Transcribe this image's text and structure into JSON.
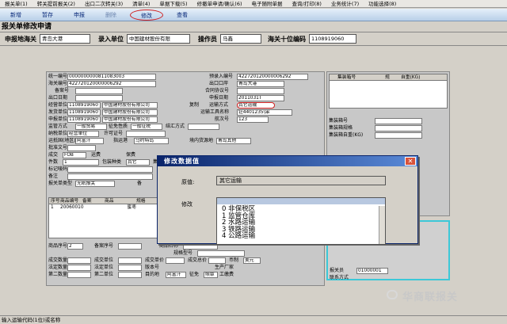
{
  "menu": [
    "报关单(1)",
    "转关提前报关(2)",
    "出口二次转关(3)",
    "清单(4)",
    "单据下载(5)",
    "修撤单申请/确认(6)",
    "电子随附单据",
    "查询/打印(8)",
    "业务统计(7)",
    "功能选择(8)"
  ],
  "toolbar": {
    "new": "新增",
    "save": "暂存",
    "declare": "申报",
    "delete": "删除",
    "modify": "修改",
    "view": "查看"
  },
  "window_title": "报关单修改申请",
  "header": {
    "customs_label": "申报地海关",
    "customs_value": "青岛大港",
    "unit_label": "录入单位",
    "unit_value": "中国建材股份有限",
    "operator_label": "操作员",
    "operator_value": "马鑫",
    "code_label": "海关十位编码",
    "code_value": "1108919060"
  },
  "form": {
    "unified_no_label": "统一编号",
    "unified_no": "0000000000811083003",
    "pre_entry_label": "预录入编号",
    "pre_entry": "422720120000006292",
    "customs_no_label": "海关编号",
    "customs_no": "422720120000006292",
    "exit_port_label": "出口口岸",
    "exit_port": "青岛大港",
    "filing_label": "备案号",
    "contract_label": "合同协议号",
    "export_date_label": "出口日期",
    "declare_date_label": "申报日期",
    "declare_date": "2011031T",
    "operating_unit_label": "经营单位",
    "operating_unit_code": "1108919060",
    "operating_unit_name": "中国建材股份有限公司",
    "transport_mode_label": "运输方式",
    "transport_mode": "其它运输",
    "copy_label": "复制",
    "shipper_label": "发货单位",
    "shipper_code": "1108919060",
    "shipper_name": "中国建材股份有限公司",
    "transport_tool_label": "运输工具名称",
    "transport_tool": "钍4401235\\串",
    "applicant_label": "申报单位",
    "applicant_code": "1108919060",
    "applicant_name": "中国建材股份有限公司",
    "voyage_label": "航次号",
    "voyage": "123",
    "trade_mode_label": "贸易方式",
    "trade_mode_value": "一般贸易",
    "supervision_label": "监管方式",
    "tax_nature_label": "征免性质",
    "tax_nature_value": "一般征税",
    "settlement_label": "结汇方式",
    "tax_unit_label": "纳税单位",
    "tax_unit_value": "经营单位",
    "license_label": "许可证号",
    "dest_country_label": "运抵国(地区)",
    "dest_country": "阿富汗",
    "port_label": "指运港",
    "port": "马约特岛",
    "domestic_label": "境内货源地",
    "domestic_value": "青岛其他",
    "approval_label": "批准文号",
    "deal_label": "成交",
    "deal_value": "FOB",
    "freight_label": "运费",
    "premium_label": "保费",
    "pieces_label": "件数",
    "pieces": "1",
    "package_label": "包装种类",
    "package": "其它",
    "container_label": "集装",
    "marks_label": "标记唛码",
    "remarks_label": "备注",
    "declaration_type_label": "报关单类型",
    "declaration_type": "无纸报关",
    "other_label": "备",
    "goods_headers": [
      "序号",
      "商品编号",
      "备案",
      "商品",
      "规格"
    ],
    "goods_rows": [
      [
        "1",
        "20060010",
        "",
        "蜜枣",
        ""
      ]
    ],
    "goods_no_label": "商品序号",
    "goods_no": "2",
    "filing_no_label": "备案序号",
    "goods_name_label": "商品名称",
    "spec_label": "规格型号",
    "deal_unit_label": "成交单位",
    "deal_qty_label": "成交数量",
    "deal_price_label": "成交单价",
    "deal_total_label": "成交总价",
    "currency_label": "币制",
    "currency": "美元",
    "legal_qty_label": "法定数量",
    "legal_unit_label": "法定单位",
    "version_label": "版本号",
    "origin_label": "生产厂家",
    "second_qty_label": "第二数量",
    "second_unit_label": "第二单位",
    "dest_label": "目的地",
    "dest_value": "阿富汗",
    "exempt_label": "征免",
    "tax_exempt": "照章",
    "goods_tag_label": "工缴费"
  },
  "right_panel": {
    "container_no_label": "集装箱号",
    "spec_col": "规",
    "weight_col": "自重(KG)",
    "container_field_label": "集装箱号",
    "container_spec_label": "集装箱规格",
    "container_weight_label": "集装箱自重(KG)",
    "cargo_label": "货场代码",
    "declarant_label": "报关员",
    "declarant_value": "01000001",
    "contact_label": "联系方式"
  },
  "dialog": {
    "title": "修改数据值",
    "original_label": "原值:",
    "original_value": "其它运输",
    "modify_label": "修改",
    "options": [
      "0  非保税区",
      "1  监管仓库",
      "2  水路运输",
      "3  铁路运输",
      "4  公路运输"
    ]
  },
  "status": "输入运输代码(1位)或名称",
  "watermark": "华商联报关"
}
